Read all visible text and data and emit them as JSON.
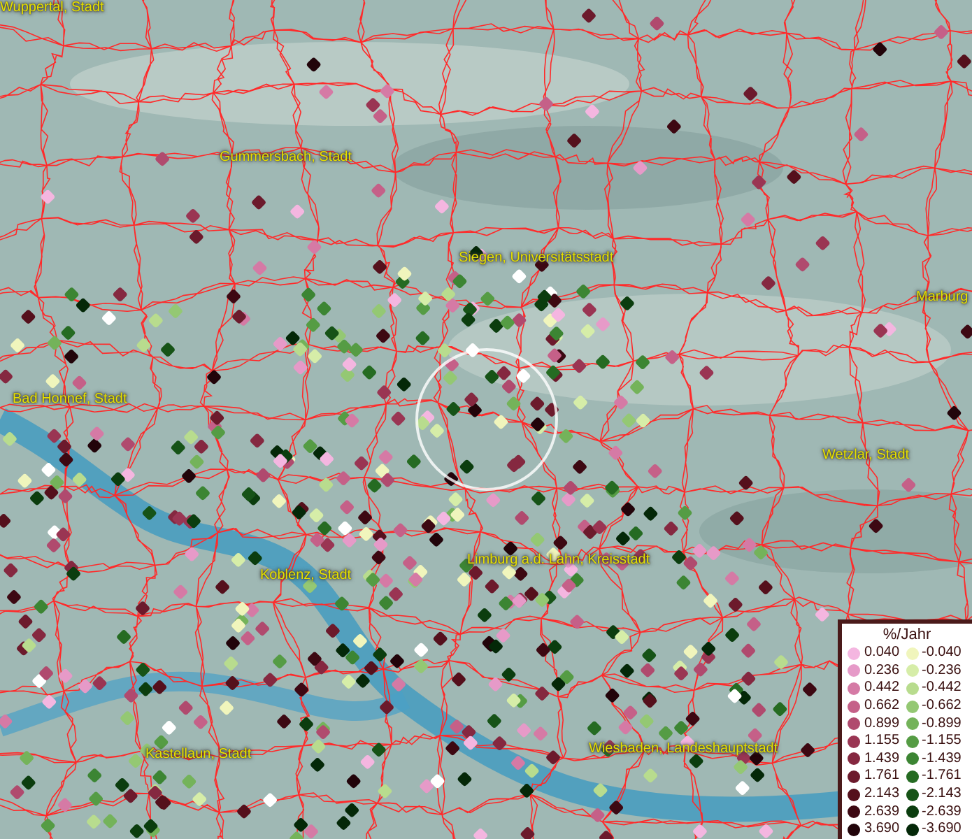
{
  "map": {
    "places": [
      {
        "name": "Wuppertal, Stadt"
      },
      {
        "name": "Gummersbach, Stadt"
      },
      {
        "name": "Siegen, Universitätsstadt"
      },
      {
        "name": "Marburg"
      },
      {
        "name": "Bad Honnef, Stadt"
      },
      {
        "name": "Wetzlar, Stadt"
      },
      {
        "name": "Koblenz, Stadt"
      },
      {
        "name": "Limburg a.d. Lahn, Kreisstadt"
      },
      {
        "name": "Kastellaun, Stadt"
      },
      {
        "name": "Wiesbaden, Landeshauptstadt"
      }
    ]
  },
  "legend": {
    "title": "%/Jahr",
    "rows": [
      {
        "pos": {
          "label": "0.040",
          "color": "#f4b6e0"
        },
        "neg": {
          "label": "-0.040",
          "color": "#f0f5bc"
        }
      },
      {
        "pos": {
          "label": "0.236",
          "color": "#e69ac8"
        },
        "neg": {
          "label": "-0.236",
          "color": "#d6eda8"
        }
      },
      {
        "pos": {
          "label": "0.442",
          "color": "#d57aa5"
        },
        "neg": {
          "label": "-0.442",
          "color": "#b8dc8e"
        }
      },
      {
        "pos": {
          "label": "0.662",
          "color": "#c56088"
        },
        "neg": {
          "label": "-0.662",
          "color": "#94c873"
        }
      },
      {
        "pos": {
          "label": "0.899",
          "color": "#b04a6e"
        },
        "neg": {
          "label": "-0.899",
          "color": "#74b35a"
        }
      },
      {
        "pos": {
          "label": "1.155",
          "color": "#9a3553"
        },
        "neg": {
          "label": "-1.155",
          "color": "#559c44"
        }
      },
      {
        "pos": {
          "label": "1.439",
          "color": "#852840"
        },
        "neg": {
          "label": "-1.439",
          "color": "#3c8533"
        }
      },
      {
        "pos": {
          "label": "1.761",
          "color": "#6c1a2c"
        },
        "neg": {
          "label": "-1.761",
          "color": "#256b22"
        }
      },
      {
        "pos": {
          "label": "2.143",
          "color": "#55101c"
        },
        "neg": {
          "label": "-2.143",
          "color": "#165317"
        }
      },
      {
        "pos": {
          "label": "2.639",
          "color": "#3d0812"
        },
        "neg": {
          "label": "-2.639",
          "color": "#0b3d0e"
        }
      },
      {
        "pos": {
          "label": "3.690",
          "color": "#22040a"
        },
        "neg": {
          "label": "-3.690",
          "color": "#042808"
        }
      }
    ]
  }
}
